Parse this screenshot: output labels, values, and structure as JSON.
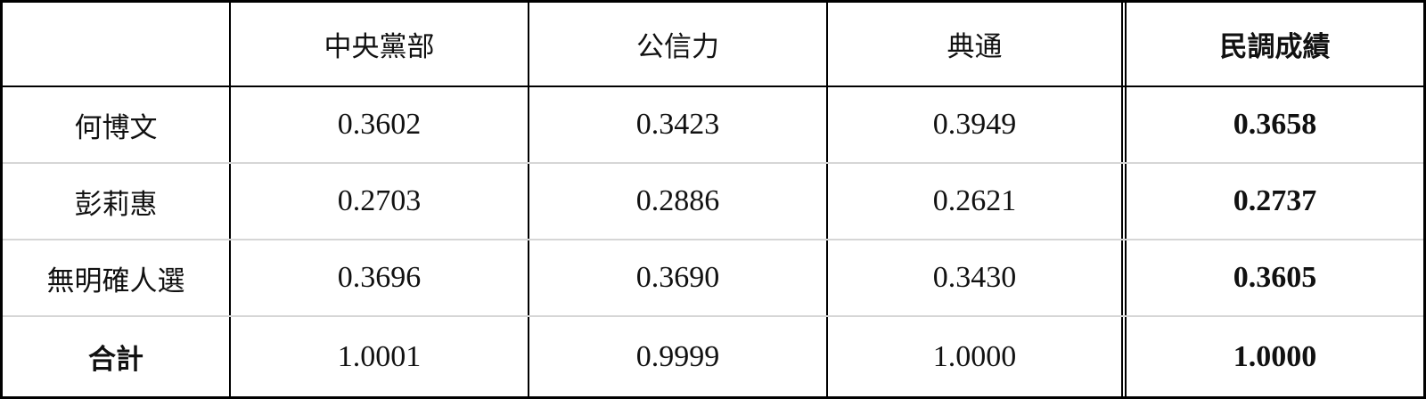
{
  "table": {
    "headers": [
      "",
      "中央黨部",
      "公信力",
      "典通",
      "民調成績"
    ],
    "rows": [
      {
        "label": "何博文",
        "values": [
          "0.3602",
          "0.3423",
          "0.3949",
          "0.3658"
        ]
      },
      {
        "label": "彭莉惠",
        "values": [
          "0.2703",
          "0.2886",
          "0.2621",
          "0.2737"
        ]
      },
      {
        "label": "無明確人選",
        "values": [
          "0.3696",
          "0.3690",
          "0.3430",
          "0.3605"
        ]
      },
      {
        "label": "合計",
        "values": [
          "1.0001",
          "0.9999",
          "1.0000",
          "1.0000"
        ]
      }
    ]
  }
}
